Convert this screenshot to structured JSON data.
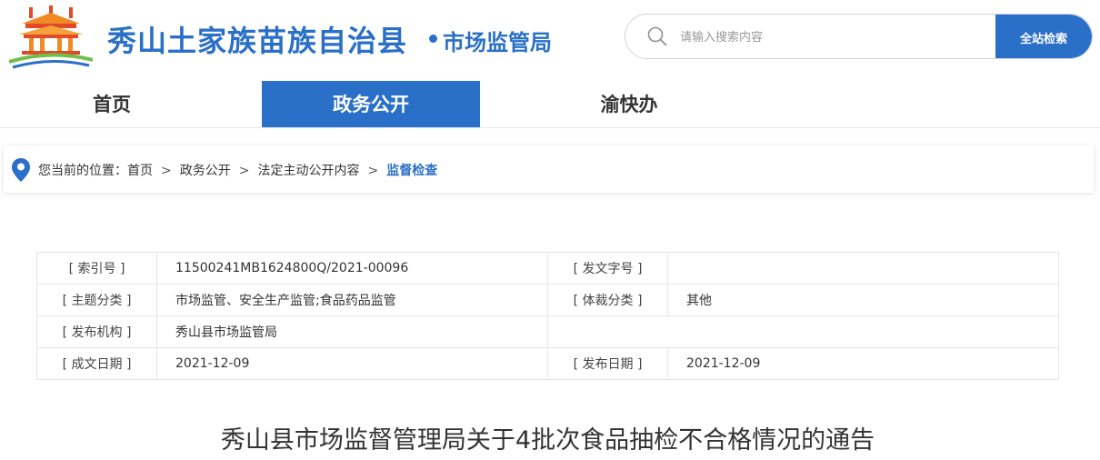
{
  "header": {
    "site_title": "秀山土家族苗族自治县",
    "dept_title": "市场监管局",
    "logo_icon": "city-gate-logo",
    "search": {
      "placeholder": "请输入搜索内容",
      "button_label": "全站检索"
    }
  },
  "nav": {
    "items": [
      {
        "label": "首页"
      },
      {
        "label": "政务公开"
      },
      {
        "label": "渝快办"
      }
    ],
    "active_index": 1
  },
  "breadcrumb": {
    "prefix": "您当前的位置：",
    "items": [
      "首页",
      "政务公开",
      "法定主动公开内容",
      "监督检查"
    ],
    "separator": ">"
  },
  "info": {
    "rows": [
      {
        "k1": "[ 索引号 ]",
        "v1": "11500241MB1624800Q/2021-00096",
        "k2": "[ 发文字号 ]",
        "v2": ""
      },
      {
        "k1": "[ 主题分类 ]",
        "v1": "市场监管、安全生产监管;食品药品监管",
        "k2": "[ 体裁分类 ]",
        "v2": "其他"
      },
      {
        "k1": "[ 发布机构 ]",
        "v1": "秀山县市场监管局"
      },
      {
        "k1": "[ 成文日期 ]",
        "v1": "2021-12-09",
        "k2": "[ 发布日期 ]",
        "v2": "2021-12-09"
      }
    ]
  },
  "article": {
    "title": "秀山县市场监督管理局关于4批次食品抽检不合格情况的通告"
  },
  "colors": {
    "brand_blue": "#2a6fc8",
    "logo_orange": "#f08a24",
    "logo_red": "#e04a2a",
    "logo_green": "#6fbf4a"
  }
}
